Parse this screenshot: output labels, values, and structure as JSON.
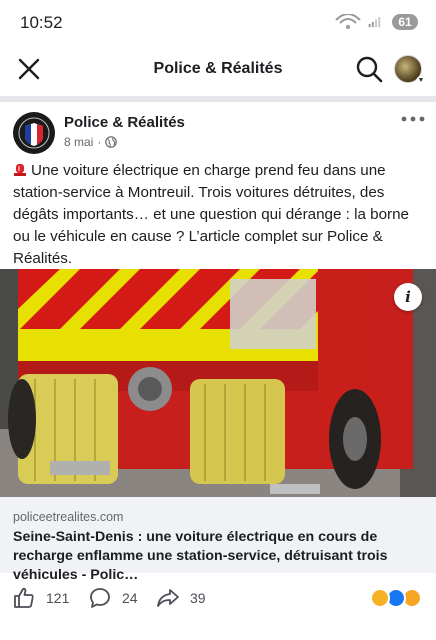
{
  "status_bar": {
    "time": "10:52",
    "battery": "61",
    "wifi_icon": "wifi-icon",
    "signal_icon": "signal-icon"
  },
  "header": {
    "title": "Police & Réalités",
    "close_icon": "close-icon",
    "search_icon": "search-icon"
  },
  "post": {
    "page_name": "Police & Réalités",
    "date": "8 mai",
    "separator": "·",
    "audience_icon": "globe-icon",
    "text": "Une voiture électrique en charge prend feu dans une station-service à Montreuil. Trois voitures détruites, des dégâts importants… et une question qui dérange : la borne ou le véhicule en cause ? L’article complet sur Police & Réalités.",
    "image_info": "i"
  },
  "link": {
    "domain": "policeetrealites.com",
    "title": "Seine-Saint-Denis : une voiture électrique en cours de recharge enflamme une station-service, détruisant trois véhicules - Polic…"
  },
  "actions": {
    "likes": "121",
    "comments": "24",
    "shares": "39"
  },
  "colors": {
    "divider": "#e4e6eb",
    "link_bg": "#f0f2f5",
    "text": "#1c1e21",
    "muted": "#65676b",
    "like_blue": "#1877f2"
  }
}
